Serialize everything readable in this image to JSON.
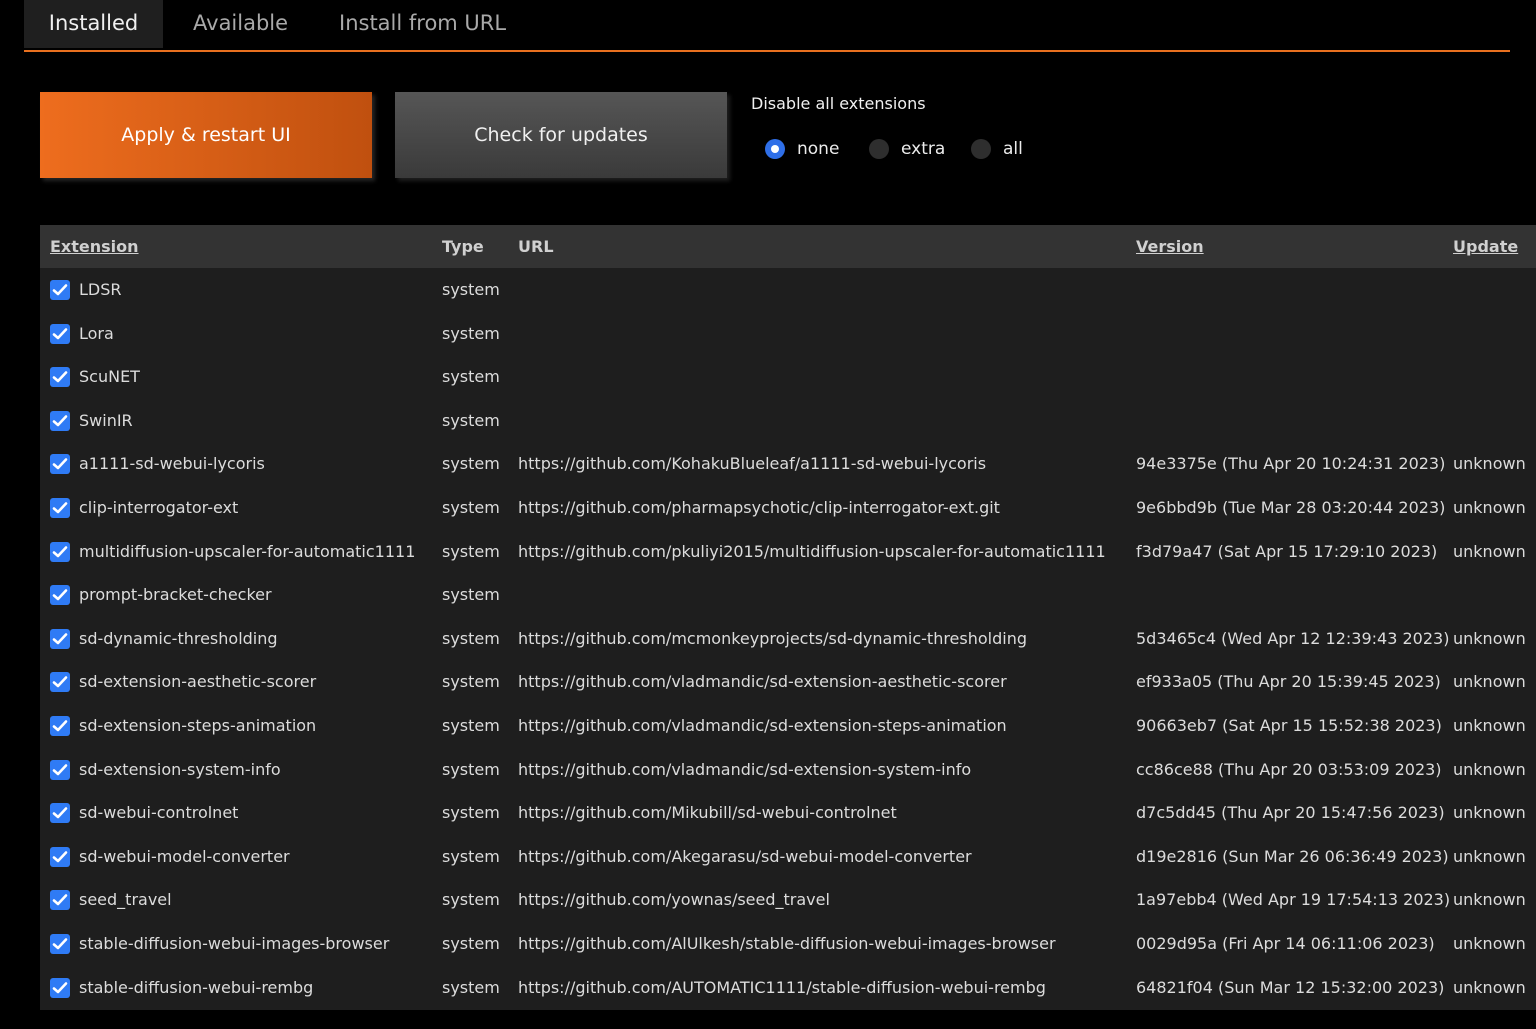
{
  "tabs": [
    {
      "label": "Installed",
      "active": true
    },
    {
      "label": "Available",
      "active": false
    },
    {
      "label": "Install from URL",
      "active": false
    }
  ],
  "buttons": {
    "apply": "Apply & restart UI",
    "check": "Check for updates"
  },
  "disable": {
    "label": "Disable all extensions",
    "options": [
      "none",
      "extra",
      "all"
    ],
    "selected": "none"
  },
  "table": {
    "headers": {
      "extension": "Extension",
      "type": "Type",
      "url": "URL",
      "version": "Version",
      "update": "Update"
    },
    "rows": [
      {
        "name": "LDSR",
        "type": "system",
        "url": "",
        "version": "",
        "update": "",
        "enabled": true
      },
      {
        "name": "Lora",
        "type": "system",
        "url": "",
        "version": "",
        "update": "",
        "enabled": true
      },
      {
        "name": "ScuNET",
        "type": "system",
        "url": "",
        "version": "",
        "update": "",
        "enabled": true
      },
      {
        "name": "SwinIR",
        "type": "system",
        "url": "",
        "version": "",
        "update": "",
        "enabled": true
      },
      {
        "name": "a1111-sd-webui-lycoris",
        "type": "system",
        "url": "https://github.com/KohakuBlueleaf/a1111-sd-webui-lycoris",
        "version": "94e3375e (Thu Apr 20 10:24:31 2023)",
        "update": "unknown",
        "enabled": true
      },
      {
        "name": "clip-interrogator-ext",
        "type": "system",
        "url": "https://github.com/pharmapsychotic/clip-interrogator-ext.git",
        "version": "9e6bbd9b (Tue Mar 28 03:20:44 2023)",
        "update": "unknown",
        "enabled": true
      },
      {
        "name": "multidiffusion-upscaler-for-automatic1111",
        "type": "system",
        "url": "https://github.com/pkuliyi2015/multidiffusion-upscaler-for-automatic1111",
        "version": "f3d79a47 (Sat Apr 15 17:29:10 2023)",
        "update": "unknown",
        "enabled": true
      },
      {
        "name": "prompt-bracket-checker",
        "type": "system",
        "url": "",
        "version": "",
        "update": "",
        "enabled": true
      },
      {
        "name": "sd-dynamic-thresholding",
        "type": "system",
        "url": "https://github.com/mcmonkeyprojects/sd-dynamic-thresholding",
        "version": "5d3465c4 (Wed Apr 12 12:39:43 2023)",
        "update": "unknown",
        "enabled": true
      },
      {
        "name": "sd-extension-aesthetic-scorer",
        "type": "system",
        "url": "https://github.com/vladmandic/sd-extension-aesthetic-scorer",
        "version": "ef933a05 (Thu Apr 20 15:39:45 2023)",
        "update": "unknown",
        "enabled": true
      },
      {
        "name": "sd-extension-steps-animation",
        "type": "system",
        "url": "https://github.com/vladmandic/sd-extension-steps-animation",
        "version": "90663eb7 (Sat Apr 15 15:52:38 2023)",
        "update": "unknown",
        "enabled": true
      },
      {
        "name": "sd-extension-system-info",
        "type": "system",
        "url": "https://github.com/vladmandic/sd-extension-system-info",
        "version": "cc86ce88 (Thu Apr 20 03:53:09 2023)",
        "update": "unknown",
        "enabled": true
      },
      {
        "name": "sd-webui-controlnet",
        "type": "system",
        "url": "https://github.com/Mikubill/sd-webui-controlnet",
        "version": "d7c5dd45 (Thu Apr 20 15:47:56 2023)",
        "update": "unknown",
        "enabled": true
      },
      {
        "name": "sd-webui-model-converter",
        "type": "system",
        "url": "https://github.com/Akegarasu/sd-webui-model-converter",
        "version": "d19e2816 (Sun Mar 26 06:36:49 2023)",
        "update": "unknown",
        "enabled": true
      },
      {
        "name": "seed_travel",
        "type": "system",
        "url": "https://github.com/yownas/seed_travel",
        "version": "1a97ebb4 (Wed Apr 19 17:54:13 2023)",
        "update": "unknown",
        "enabled": true
      },
      {
        "name": "stable-diffusion-webui-images-browser",
        "type": "system",
        "url": "https://github.com/AlUlkesh/stable-diffusion-webui-images-browser",
        "version": "0029d95a (Fri Apr 14 06:11:06 2023)",
        "update": "unknown",
        "enabled": true
      },
      {
        "name": "stable-diffusion-webui-rembg",
        "type": "system",
        "url": "https://github.com/AUTOMATIC1111/stable-diffusion-webui-rembg",
        "version": "64821f04 (Sun Mar 12 15:32:00 2023)",
        "update": "unknown",
        "enabled": true
      }
    ]
  },
  "colors": {
    "accent": "#e8701f",
    "checkbox": "#2f7bf5",
    "radio_selected": "#2f6fe8"
  }
}
